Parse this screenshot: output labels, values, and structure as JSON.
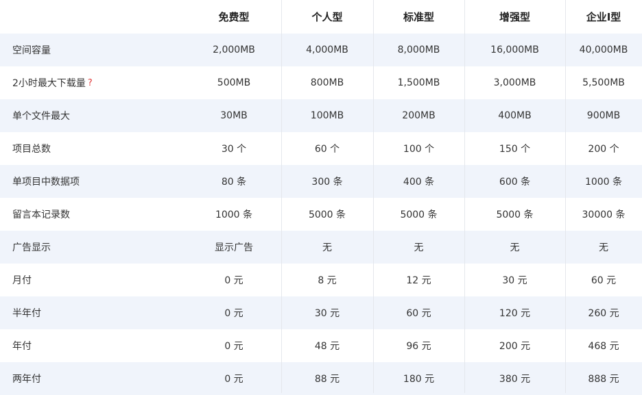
{
  "plans": [
    "免费型",
    "个人型",
    "标准型",
    "增强型",
    "企业I型"
  ],
  "help_icon_glyph": "?",
  "rows": [
    {
      "label": "空间容量",
      "values": [
        "2,000MB",
        "4,000MB",
        "8,000MB",
        "16,000MB",
        "40,000MB"
      ]
    },
    {
      "label": "2小时最大下载量",
      "values": [
        "500MB",
        "800MB",
        "1,500MB",
        "3,000MB",
        "5,500MB"
      ]
    },
    {
      "label": "单个文件最大",
      "values": [
        "30MB",
        "100MB",
        "200MB",
        "400MB",
        "900MB"
      ]
    },
    {
      "label": "项目总数",
      "values": [
        "30 个",
        "60 个",
        "100 个",
        "150 个",
        "200 个"
      ]
    },
    {
      "label": "单项目中数据项",
      "values": [
        "80 条",
        "300 条",
        "400 条",
        "600 条",
        "1000 条"
      ]
    },
    {
      "label": "留言本记录数",
      "values": [
        "1000 条",
        "5000 条",
        "5000 条",
        "5000 条",
        "30000 条"
      ]
    },
    {
      "label": "广告显示",
      "values": [
        "显示广告",
        "无",
        "无",
        "无",
        "无"
      ]
    },
    {
      "label": "月付",
      "values": [
        "0 元",
        "8 元",
        "12 元",
        "30 元",
        "60 元"
      ]
    },
    {
      "label": "半年付",
      "values": [
        "0 元",
        "30 元",
        "60 元",
        "120 元",
        "260 元"
      ]
    },
    {
      "label": "年付",
      "values": [
        "0 元",
        "48 元",
        "96 元",
        "200 元",
        "468 元"
      ]
    },
    {
      "label": "两年付",
      "values": [
        "0 元",
        "88 元",
        "180 元",
        "380 元",
        "888 元"
      ]
    }
  ],
  "colors": {
    "shaded_row": "#f0f4fb",
    "help_mark": "#e03c3c",
    "divider": "#e4e7ec"
  }
}
